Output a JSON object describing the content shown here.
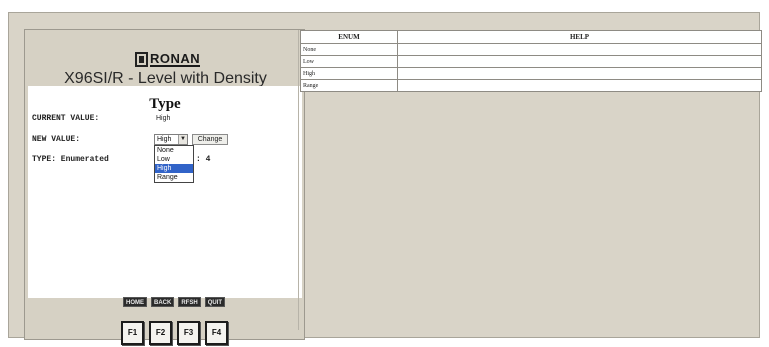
{
  "device": {
    "logo_text": "RONAN",
    "title": "X96SI/R - Level with Density"
  },
  "screen": {
    "title": "Type",
    "current_value_label": "CURRENT VALUE:",
    "current_value": "High",
    "new_value_label": "NEW VALUE:",
    "selected_value": "High",
    "change_button": "Change",
    "type_label": "TYPE: Enumerated",
    "type_suffix": ": 4",
    "options": [
      "None",
      "Low",
      "High",
      "Range"
    ],
    "highlighted_option": "High"
  },
  "softkeys": [
    "HOME",
    "BACK",
    "RFSH",
    "QUIT"
  ],
  "function_keys": [
    "F1",
    "F2",
    "F3",
    "F4"
  ],
  "enum_table": {
    "headers": [
      "ENUM",
      "HELP"
    ],
    "rows": [
      {
        "enum": "None",
        "help": ""
      },
      {
        "enum": "Low",
        "help": ""
      },
      {
        "enum": "High",
        "help": ""
      },
      {
        "enum": "Range",
        "help": ""
      }
    ]
  },
  "colors": {
    "panel_bg": "#d6d1c4",
    "outer_bg": "#d9d4c8",
    "highlight": "#3163c8",
    "softkey_bg": "#2b2b2b"
  }
}
